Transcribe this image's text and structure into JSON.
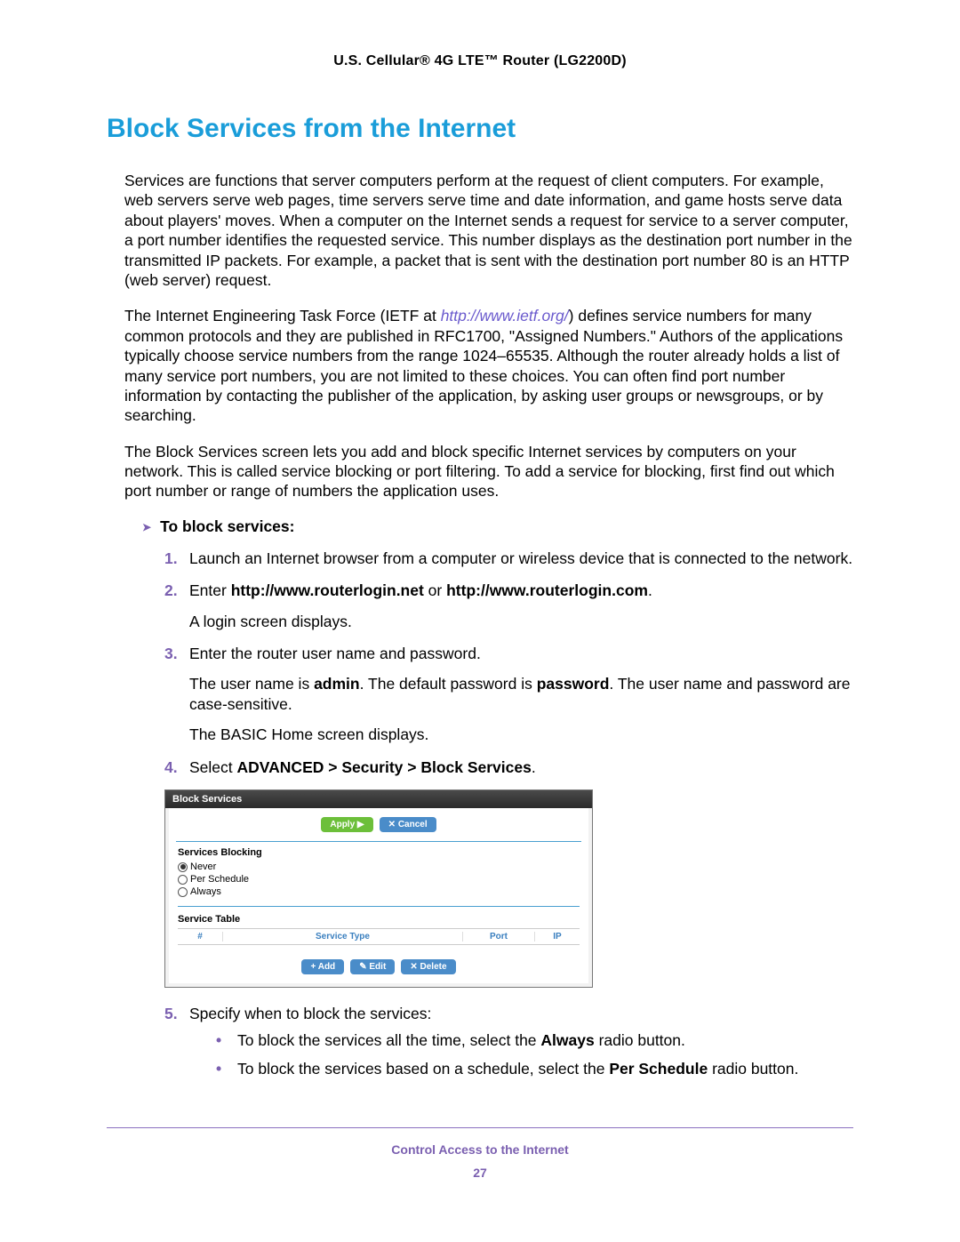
{
  "header": {
    "title": "U.S. Cellular® 4G LTE™ Router (LG2200D)"
  },
  "h1": "Block Services from the Internet",
  "para1a": "Services are functions that server computers perform at the request of client computers. For example, web servers serve web pages, time servers serve time and date information, and game hosts serve data about players' moves. When a computer on the Internet sends a request for service to a server computer, a port number identifies the requested service. This number displays as the destination port number in the transmitted IP packets. For example, a packet that is sent with the destination port number 80 is an HTTP (web server) request.",
  "para2_pre": "The Internet Engineering Task Force (IETF at ",
  "para2_link": "http://www.ietf.org/",
  "para2_post": ") defines service numbers for many common protocols and they are published in RFC1700, \"Assigned Numbers.\" Authors of the applications typically choose service numbers from the range 1024–65535. Although the router already holds a list of many service port numbers, you are not limited to these choices. You can often find port number information by contacting the publisher of the application, by asking user groups or newsgroups, or by searching.",
  "para3": "The Block Services screen lets you add and block specific Internet services by computers on your network. This is called service blocking or port filtering. To add a service for blocking, first find out which port number or range of numbers the application uses.",
  "section_lead": "To block services:",
  "steps": {
    "s1_num": "1.",
    "s1": "Launch an Internet browser from a computer or wireless device that is connected to the network.",
    "s2_num": "2.",
    "s2_pre": "Enter ",
    "s2_b1": "http://www.routerlogin.net",
    "s2_mid": " or ",
    "s2_b2": "http://www.routerlogin.com",
    "s2_end": ".",
    "s2_sub": "A login screen displays.",
    "s3_num": "3.",
    "s3": "Enter the router user name and password.",
    "s3_sub1_pre": "The user name is ",
    "s3_sub1_b1": "admin",
    "s3_sub1_mid": ". The default password is ",
    "s3_sub1_b2": "password",
    "s3_sub1_post": ". The user name and password are case-sensitive.",
    "s3_sub2": "The BASIC Home screen displays.",
    "s4_num": "4.",
    "s4_pre": "Select ",
    "s4_b": "ADVANCED > Security > Block Services",
    "s4_end": ".",
    "s5_num": "5.",
    "s5": "Specify when to block the services:",
    "s5_b1_pre": "To block the services all the time, select the ",
    "s5_b1_b": "Always",
    "s5_b1_post": " radio button.",
    "s5_b2_pre": "To block the services based on a schedule, select the ",
    "s5_b2_b": "Per Schedule",
    "s5_b2_post": " radio button."
  },
  "panel": {
    "title": "Block Services",
    "apply": "Apply ▶",
    "cancel": "✕ Cancel",
    "section1": "Services Blocking",
    "opt_never": "Never",
    "opt_per_schedule": "Per Schedule",
    "opt_always": "Always",
    "section2": "Service Table",
    "col_num": "#",
    "col_type": "Service Type",
    "col_port": "Port",
    "col_ip": "IP",
    "add": "+ Add",
    "edit": "✎ Edit",
    "delete": "✕ Delete"
  },
  "footer": {
    "section": "Control Access to the Internet",
    "page": "27"
  }
}
